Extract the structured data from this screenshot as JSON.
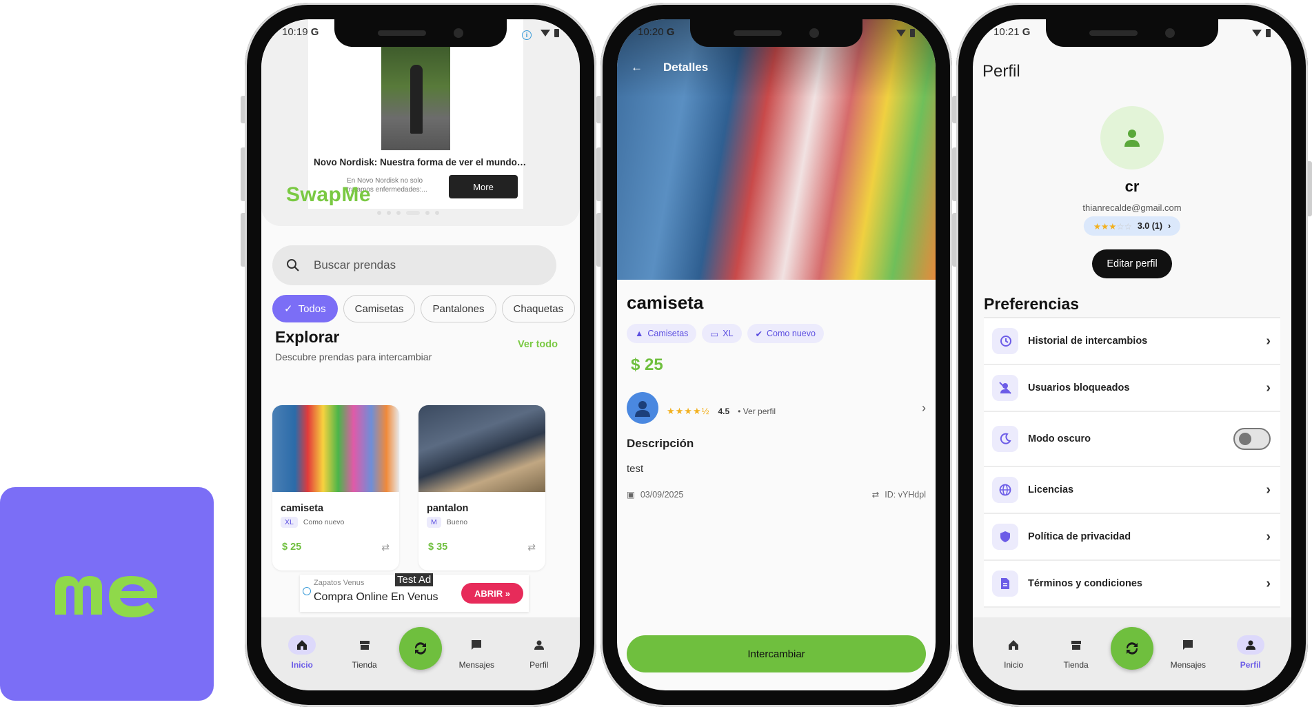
{
  "colors": {
    "primary": "#7b6ef6",
    "accent": "#6fbf3e",
    "ad_cta": "#e72b5a",
    "star": "#f2b01e"
  },
  "logo": {
    "text": "me"
  },
  "screen1": {
    "status_time": "10:19",
    "status_g": "G",
    "ad": {
      "title": "Novo Nordisk: Nuestra forma de ver el mundo…",
      "subtitle": "En Novo Nordisk no solo tratamos enfermedades:...",
      "cta": "More"
    },
    "brand": "SwapMe",
    "search_placeholder": "Buscar prendas",
    "chips": [
      "Todos",
      "Camisetas",
      "Pantalones",
      "Chaquetas"
    ],
    "explore": {
      "title": "Explorar",
      "subtitle": "Descubre prendas para intercambiar",
      "see_all": "Ver todo"
    },
    "items": [
      {
        "name": "camiseta",
        "size": "XL",
        "condition": "Como nuevo",
        "price": "$ 25"
      },
      {
        "name": "pantalon",
        "size": "M",
        "condition": "Bueno",
        "price": "$ 35"
      }
    ],
    "banner": {
      "advertiser": "Zapatos Venus",
      "headline": "Compra Online En Venus",
      "test_label": "Test Ad",
      "cta": "ABRIR"
    },
    "nav": [
      "Inicio",
      "Tienda",
      "Mensajes",
      "Perfil"
    ]
  },
  "screen2": {
    "status_time": "10:20",
    "status_g": "G",
    "header": "Detalles",
    "title": "camiseta",
    "tags": [
      "Camisetas",
      "XL",
      "Como nuevo"
    ],
    "price": "$ 25",
    "owner": {
      "stars": "★★★★½",
      "rating": "4.5",
      "link": "• Ver perfil"
    },
    "description_label": "Descripción",
    "description": "test",
    "date": "03/09/2025",
    "id": "ID: vYHdpl",
    "cta": "Intercambiar"
  },
  "screen3": {
    "status_time": "10:21",
    "status_g": "G",
    "title": "Perfil",
    "name": "cr",
    "email": "thianrecalde@gmail.com",
    "rating": {
      "stars_on": "★★★",
      "stars_off": "☆☆",
      "label": "3.0 (1)"
    },
    "edit": "Editar perfil",
    "preferences_label": "Preferencias",
    "preferences": [
      "Historial de intercambios",
      "Usuarios bloqueados",
      "Modo oscuro",
      "Licencias",
      "Política de privacidad",
      "Términos y condiciones"
    ],
    "dark_mode_on": false,
    "nav": [
      "Inicio",
      "Tienda",
      "Mensajes",
      "Perfil"
    ]
  }
}
